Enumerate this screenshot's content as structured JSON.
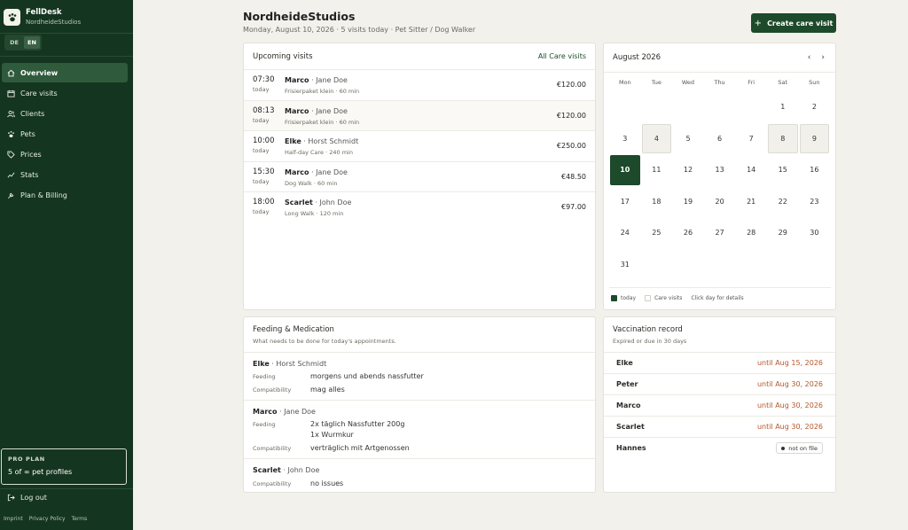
{
  "brand": {
    "name": "FellDesk",
    "workspace": "NordheideStudios"
  },
  "language": {
    "options": [
      "DE",
      "EN"
    ],
    "active": "EN"
  },
  "nav": [
    {
      "label": "Overview",
      "icon": "home-icon",
      "active": true
    },
    {
      "label": "Care visits",
      "icon": "calendar-icon",
      "active": false
    },
    {
      "label": "Clients",
      "icon": "users-icon",
      "active": false
    },
    {
      "label": "Pets",
      "icon": "paw-icon",
      "active": false
    },
    {
      "label": "Prices",
      "icon": "tag-icon",
      "active": false
    },
    {
      "label": "Stats",
      "icon": "chart-icon",
      "active": false
    },
    {
      "label": "Plan & Billing",
      "icon": "wrench-icon",
      "active": false
    }
  ],
  "plan": {
    "title": "PRO PLAN",
    "text": "5 of ∞ pet profiles"
  },
  "logout": "Log out",
  "footer": [
    "Imprint",
    "Privacy Policy",
    "Terms"
  ],
  "header": {
    "title": "NordheideStudios",
    "subtitle": "Monday, August 10, 2026 · 5 visits today · Pet Sitter / Dog Walker",
    "create_button": "Create care visit"
  },
  "upcoming": {
    "title": "Upcoming visits",
    "all_link": "All Care visits",
    "visits": [
      {
        "time": "07:30",
        "day": "today",
        "pet": "Marco",
        "owner": "Jane Doe",
        "service": "Frisierpaket klein",
        "duration": "60 min",
        "price": "€120.00"
      },
      {
        "time": "08:13",
        "day": "today",
        "pet": "Marco",
        "owner": "Jane Doe",
        "service": "Frisierpaket klein",
        "duration": "60 min",
        "price": "€120.00"
      },
      {
        "time": "10:00",
        "day": "today",
        "pet": "Elke",
        "owner": "Horst Schmidt",
        "service": "Half-day Care",
        "duration": "240 min",
        "price": "€250.00"
      },
      {
        "time": "15:30",
        "day": "today",
        "pet": "Marco",
        "owner": "Jane Doe",
        "service": "Dog Walk",
        "duration": "60 min",
        "price": "€48.50"
      },
      {
        "time": "18:00",
        "day": "today",
        "pet": "Scarlet",
        "owner": "John Doe",
        "service": "Long Walk",
        "duration": "120 min",
        "price": "€97.00"
      }
    ]
  },
  "calendar": {
    "title": "August 2026",
    "weekdays": [
      "Mon",
      "Tue",
      "Wed",
      "Thu",
      "Fri",
      "Sat",
      "Sun"
    ],
    "leading_blanks": 5,
    "days_in_month": 31,
    "today": 10,
    "visit_days": [
      4,
      8,
      9
    ],
    "legend_today": "today",
    "legend_visits": "Care visits",
    "legend_hint": "Click day for details"
  },
  "feeding": {
    "title": "Feeding & Medication",
    "subtitle": "What needs to be done for today's appointments.",
    "pets": [
      {
        "pet": "Elke",
        "owner": "Horst Schmidt",
        "rows": [
          {
            "label": "Feeding",
            "lines": [
              "morgens und abends nassfutter"
            ]
          },
          {
            "label": "Compatibility",
            "lines": [
              "mag alles"
            ]
          }
        ]
      },
      {
        "pet": "Marco",
        "owner": "Jane Doe",
        "rows": [
          {
            "label": "Feeding",
            "lines": [
              "2x täglich Nassfutter 200g",
              "1x Wurmkur"
            ]
          },
          {
            "label": "Compatibility",
            "lines": [
              "verträglich mit Artgenossen"
            ]
          }
        ]
      },
      {
        "pet": "Scarlet",
        "owner": "John Doe",
        "rows": [
          {
            "label": "Compatibility",
            "lines": [
              "no issues"
            ]
          }
        ]
      }
    ]
  },
  "vaccination": {
    "title": "Vaccination record",
    "subtitle": "Expired or due in 30 days",
    "items": [
      {
        "pet": "Elke",
        "due": "until Aug 15, 2026"
      },
      {
        "pet": "Peter",
        "due": "until Aug 30, 2026"
      },
      {
        "pet": "Marco",
        "due": "until Aug 30, 2026"
      },
      {
        "pet": "Scarlet",
        "due": "until Aug 30, 2026"
      },
      {
        "pet": "Hannes",
        "badge": "not on file"
      }
    ]
  },
  "colors": {
    "sidebar": "#14351f",
    "accent": "#1d4a2a",
    "due": "#b4562a",
    "background": "#f2f1ec"
  }
}
